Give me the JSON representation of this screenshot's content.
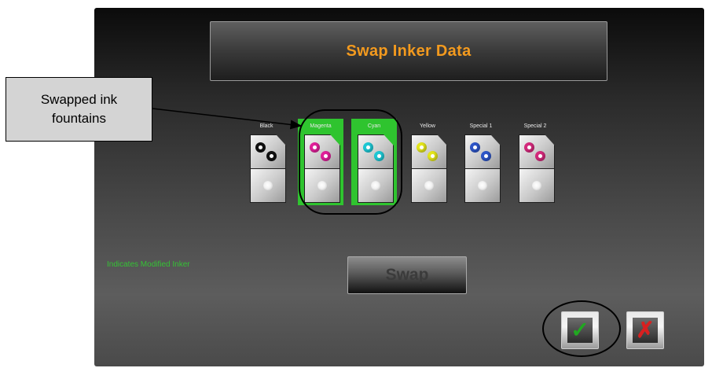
{
  "title": "Swap Inker Data",
  "inkers": [
    {
      "label": "Black",
      "modified": false,
      "color": "#111111"
    },
    {
      "label": "Magenta",
      "modified": true,
      "color": "#e0209a"
    },
    {
      "label": "Cyan",
      "modified": true,
      "color": "#1ec8d4"
    },
    {
      "label": "Yellow",
      "modified": false,
      "color": "#e4e61c"
    },
    {
      "label": "Special 1",
      "modified": false,
      "color": "#2e56c8"
    },
    {
      "label": "Special 2",
      "modified": false,
      "color": "#d42a7c"
    }
  ],
  "modified_legend": "Indicates Modified Inker",
  "swap_button_label": "Swap",
  "ok_icon": "check-icon",
  "cancel_icon": "x-icon",
  "callout": "Swapped ink\nfountains",
  "colors": {
    "title": "#f39a1e",
    "modified": "#2fc42f",
    "legend": "#35c235",
    "ok": "#21a821",
    "cancel": "#d82020"
  }
}
